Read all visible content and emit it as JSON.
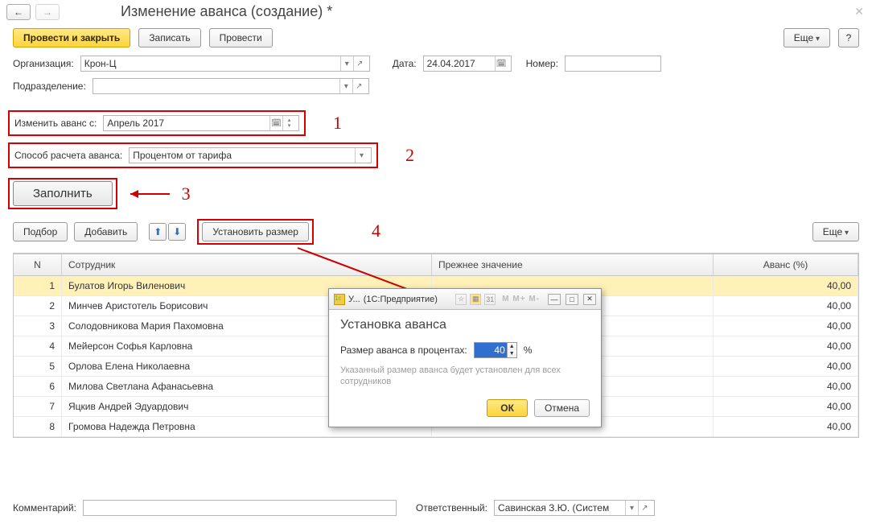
{
  "header": {
    "title": "Изменение аванса (создание) *"
  },
  "cmd": {
    "post_close": "Провести и закрыть",
    "save": "Записать",
    "post": "Провести",
    "more": "Еще",
    "help": "?"
  },
  "fields": {
    "org_label": "Организация:",
    "org_value": "Крон-Ц",
    "date_label": "Дата:",
    "date_value": "24.04.2017",
    "number_label": "Номер:",
    "number_value": "",
    "dept_label": "Подразделение:",
    "dept_value": "",
    "change_from_label": "Изменить аванс с:",
    "change_from_value": "Апрель 2017",
    "method_label": "Способ расчета аванса:",
    "method_value": "Процентом от тарифа",
    "fill": "Заполнить",
    "pick": "Подбор",
    "add": "Добавить",
    "set_size": "Установить размер",
    "more2": "Еще"
  },
  "annotations": {
    "a1": "1",
    "a2": "2",
    "a3": "3",
    "a4": "4"
  },
  "table": {
    "headers": {
      "n": "N",
      "emp": "Сотрудник",
      "prev": "Прежнее значение",
      "adv": "Аванс (%)"
    },
    "rows": [
      {
        "n": "1",
        "emp": "Булатов Игорь Виленович",
        "adv": "40,00"
      },
      {
        "n": "2",
        "emp": "Минчев Аристотель Борисович",
        "adv": "40,00"
      },
      {
        "n": "3",
        "emp": "Солодовникова Мария Пахомовна",
        "adv": "40,00"
      },
      {
        "n": "4",
        "emp": "Мейерсон Софья Карловна",
        "adv": "40,00"
      },
      {
        "n": "5",
        "emp": "Орлова Елена Николаевна",
        "adv": "40,00"
      },
      {
        "n": "6",
        "emp": "Милова Светлана Афанасьевна",
        "adv": "40,00"
      },
      {
        "n": "7",
        "emp": "Яцкив Андрей Эдуардович",
        "adv": "40,00"
      },
      {
        "n": "8",
        "emp": "Громова Надежда Петровна",
        "adv": "40,00"
      }
    ]
  },
  "footer": {
    "comment_label": "Комментарий:",
    "responsible_label": "Ответственный:",
    "responsible_value": "Савинская З.Ю. (Систем"
  },
  "dialog": {
    "caption_prefix": "У...",
    "caption_app": "(1С:Предприятие)",
    "title": "Установка аванса",
    "field_label": "Размер аванса в процентах:",
    "value": "40",
    "percent": "%",
    "hint": "Указанный размер аванса будет установлен для всех сотрудников",
    "ok": "ОК",
    "cancel": "Отмена"
  }
}
